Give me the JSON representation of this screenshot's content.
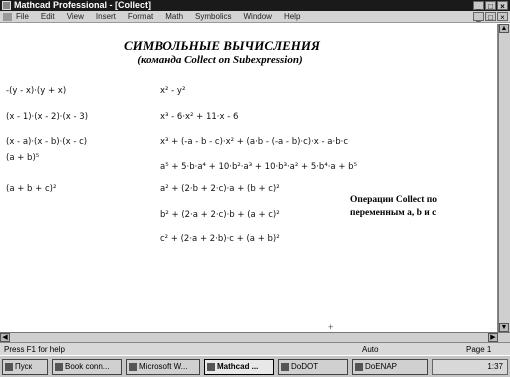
{
  "window": {
    "title": "Mathcad Professional - [Collect]",
    "controls": [
      "_",
      "□",
      "×"
    ],
    "doc_controls": [
      "_",
      "□",
      "×"
    ]
  },
  "menu": [
    "File",
    "Edit",
    "View",
    "Insert",
    "Format",
    "Math",
    "Symbolics",
    "Window",
    "Help"
  ],
  "document": {
    "heading": "СИМВОЛЬНЫЕ ВЫЧИСЛЕНИЯ",
    "subheading": "(команда Collect on Subexpression)",
    "note": "Операции Collect по переменным a, b и c",
    "rows": [
      {
        "left": "-(y - x)·(y + x)",
        "right": "x² - y²"
      },
      {
        "left": "(x - 1)·(x - 2)·(x - 3)",
        "right": "x³ - 6·x² + 11·x - 6"
      },
      {
        "left": "(x - a)·(x - b)·(x - c)",
        "right": "x³ + (-a - b - c)·x² + (a·b - (-a - b)·c)·x - a·b·c"
      },
      {
        "left": "(a + b)⁵",
        "right": "a⁵ + 5·b·a⁴ + 10·b²·a³ + 10·b³·a² + 5·b⁴·a + b⁵"
      },
      {
        "left": "(a + b + c)²",
        "right": "a² + (2·b + 2·c)·a + (b + c)²"
      },
      {
        "left": "",
        "right": "b² + (2·a + 2·c)·b + (a + c)²"
      },
      {
        "left": "",
        "right": "c² + (2·a + 2·b)·c + (a + b)²"
      }
    ]
  },
  "status": {
    "help": "Press F1 for help",
    "mode": "Auto",
    "page": "Page 1"
  },
  "taskbar": {
    "items": [
      "Пуск",
      "Book conn...",
      "Microsoft W...",
      "Mathcad ...",
      "DoDOT",
      "DoENAP"
    ],
    "active_index": 3,
    "clock": "1:37"
  }
}
